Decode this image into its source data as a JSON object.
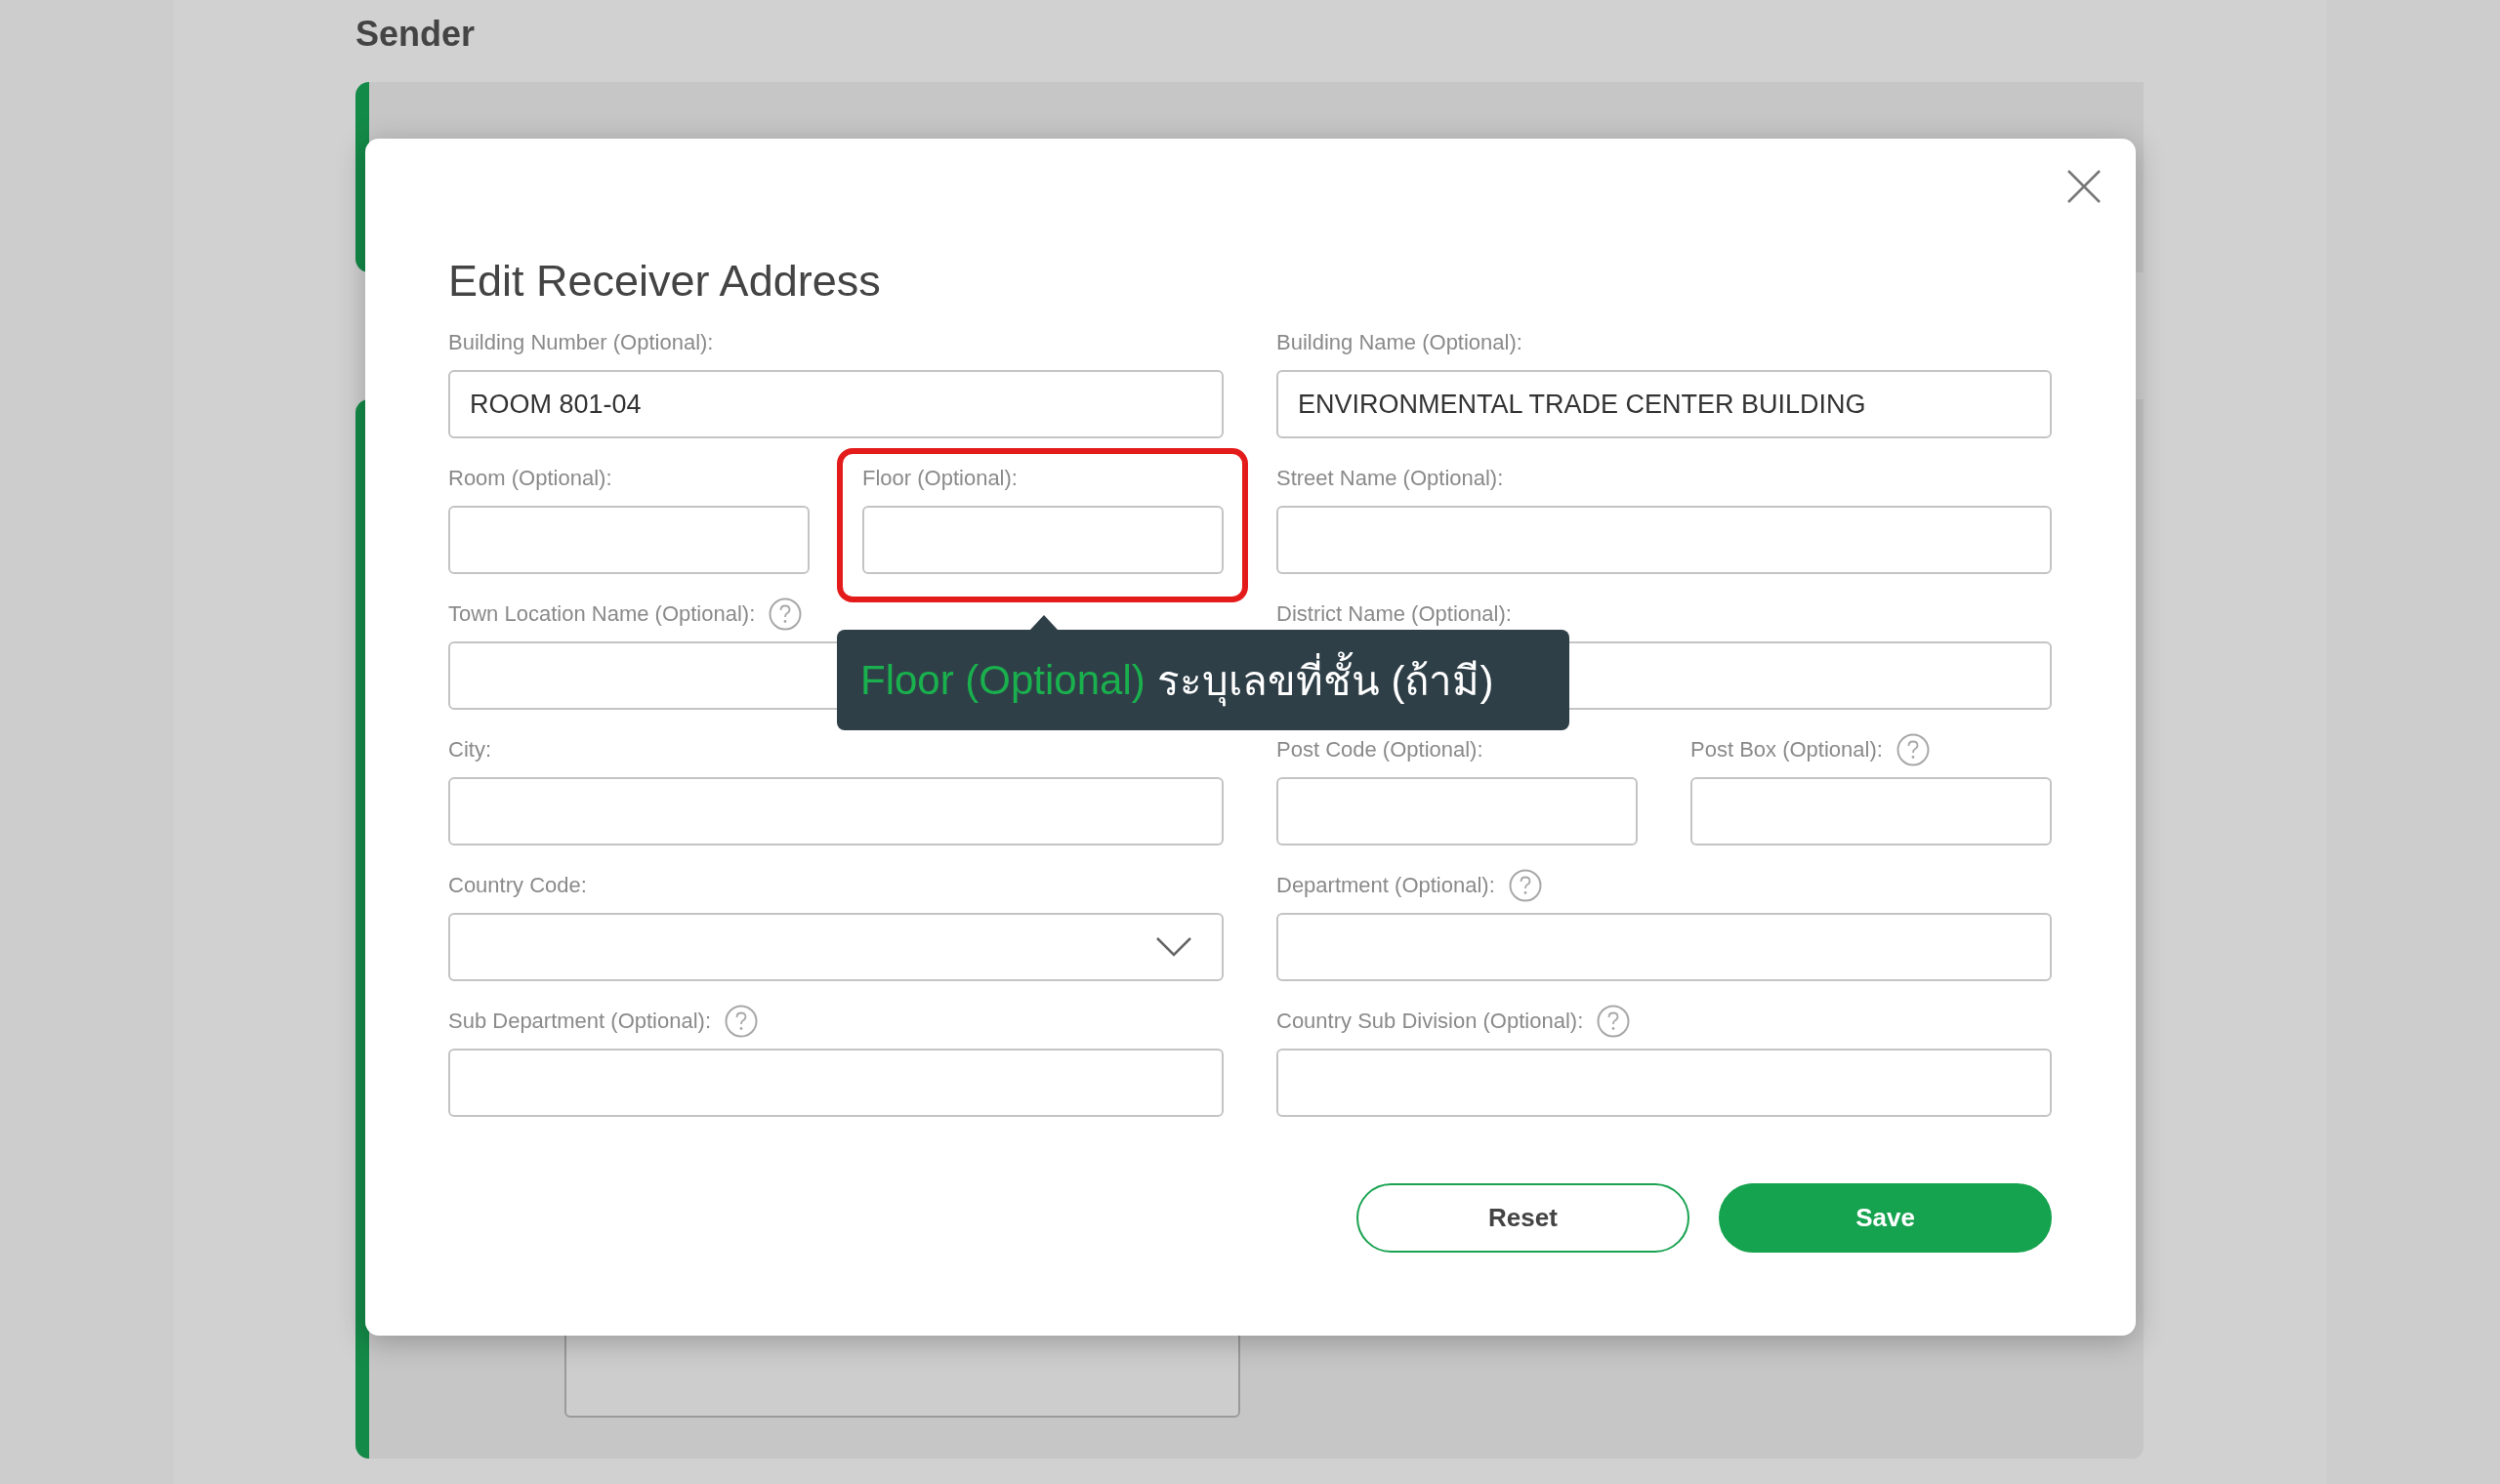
{
  "page": {
    "title": "Sender"
  },
  "dialog": {
    "title": "Edit Receiver Address",
    "rows": [
      [
        {
          "label": "Building Number (Optional):",
          "value": "ROOM 801-04",
          "kind": "text",
          "help": false,
          "highlighted": false
        },
        {
          "label": "Building Name (Optional):",
          "value": "ENVIRONMENTAL TRADE CENTER BUILDING",
          "kind": "text",
          "help": false,
          "highlighted": false
        }
      ],
      [
        {
          "fields": [
            {
              "label": "Room (Optional):",
              "kind": "text",
              "help": false,
              "highlighted": false
            },
            {
              "label": "Floor (Optional):",
              "kind": "text",
              "help": false,
              "highlighted": true
            }
          ]
        },
        {
          "label": "Street Name (Optional):",
          "kind": "text",
          "help": false,
          "highlighted": false
        }
      ],
      [
        {
          "label": "Town Location Name (Optional):",
          "kind": "text",
          "help": true,
          "highlighted": false
        },
        {
          "label": "District Name (Optional):",
          "kind": "text",
          "help": false,
          "highlighted": false
        }
      ],
      [
        {
          "label": "City:",
          "kind": "text",
          "help": false,
          "highlighted": false
        },
        {
          "fields": [
            {
              "label": "Post Code (Optional):",
              "kind": "text",
              "help": false,
              "highlighted": false
            },
            {
              "label": "Post Box (Optional):",
              "kind": "text",
              "help": true,
              "highlighted": false
            }
          ]
        }
      ],
      [
        {
          "label": "Country Code:",
          "kind": "select",
          "help": false,
          "highlighted": false
        },
        {
          "label": "Department (Optional):",
          "kind": "text",
          "help": true,
          "highlighted": false
        }
      ],
      [
        {
          "label": "Sub Department (Optional):",
          "kind": "text",
          "help": true,
          "highlighted": false
        },
        {
          "label": "Country Sub Division (Optional):",
          "kind": "text",
          "help": true,
          "highlighted": false
        }
      ]
    ],
    "buttons": [
      {
        "label": "Reset",
        "kind": "secondary"
      },
      {
        "label": "Save",
        "kind": "primary"
      }
    ]
  },
  "tooltip": {
    "title": "Floor (Optional)",
    "text": "ระบุเลขที่ชั้น (ถ้ามี)"
  }
}
